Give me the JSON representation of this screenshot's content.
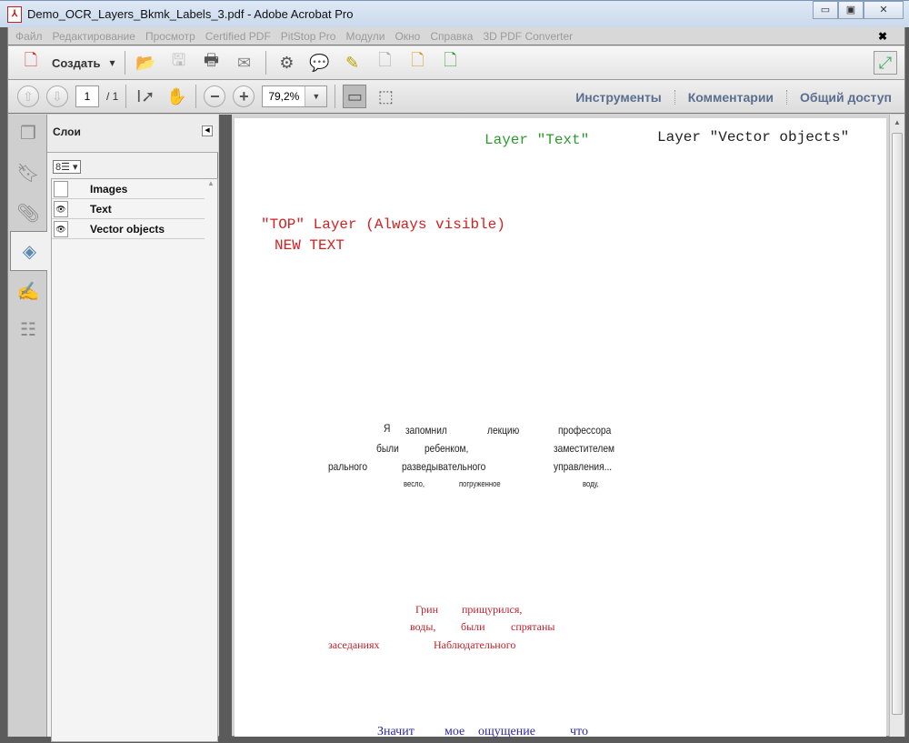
{
  "window": {
    "title": "Demo_OCR_Layers_Bkmk_Labels_3.pdf - Adobe Acrobat Pro",
    "minimize": "▭",
    "maximize": "▣",
    "close": "✕"
  },
  "menu": [
    "Файл",
    "Редактирование",
    "Просмотр",
    "Certified PDF",
    "PitStop Pro",
    "Модули",
    "Окно",
    "Справка",
    "3D PDF Converter"
  ],
  "menu_close": "✖",
  "toolbar": {
    "create_label": "Создать",
    "page_current": "1",
    "page_total": "/ 1",
    "zoom": "79,2%",
    "links": [
      "Инструменты",
      "Комментарии",
      "Общий доступ"
    ]
  },
  "panel": {
    "title": "Слои",
    "layers": [
      {
        "name": "Images",
        "visible": false
      },
      {
        "name": "Text",
        "visible": true
      },
      {
        "name": "Vector objects",
        "visible": true
      }
    ]
  },
  "document": {
    "layer_text": "Layer \"Text\"",
    "layer_vector": "Layer \"Vector objects\"",
    "top_layer": "\"TOP\" Layer (Always visible)",
    "new_text": "NEW TEXT",
    "black_words": [
      "Я",
      "запомнил",
      "лекцию",
      "профессора",
      "были",
      "ребенком,",
      "заместителем",
      "рального",
      "разведывательного",
      "управления...",
      "весло,",
      "погруженное",
      "воду,"
    ],
    "red_words": [
      "Грин",
      "прищурился,",
      "воды,",
      "были",
      "спрятаны",
      "заседаниях",
      "Наблюдательного"
    ],
    "blue_words": [
      "Значит",
      "мое",
      "ощущение",
      "что"
    ]
  },
  "colors": {
    "green": "#2e9a2e",
    "red": "#d42020",
    "blue": "#2a2aa8",
    "link": "#5a6f8e"
  }
}
